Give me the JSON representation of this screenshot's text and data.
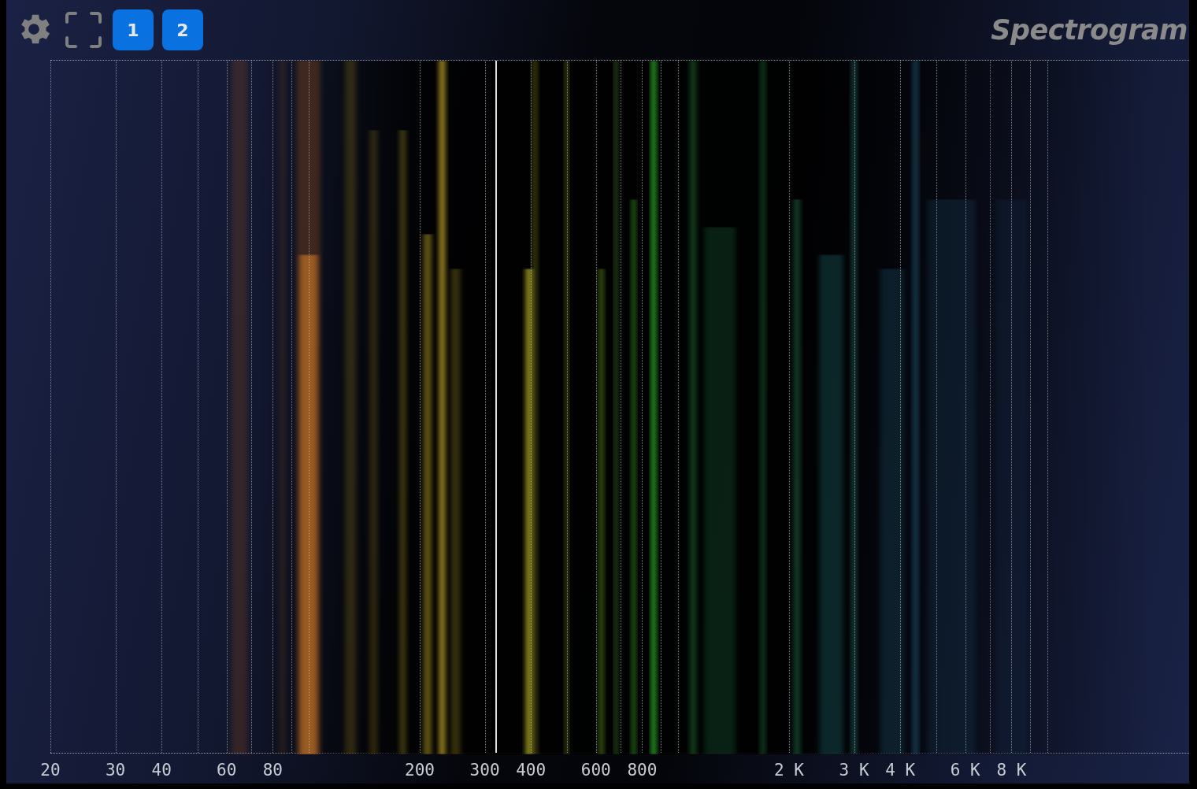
{
  "toolbar": {
    "buttons": [
      "1",
      "2"
    ]
  },
  "title": "Spectrogram",
  "x_axis": {
    "labels": [
      "20",
      "30",
      "40",
      "60",
      "80",
      "200",
      "300",
      "400",
      "600",
      "800",
      "2 K",
      "3 K",
      "4 K",
      "6 K",
      "8 K"
    ]
  }
}
